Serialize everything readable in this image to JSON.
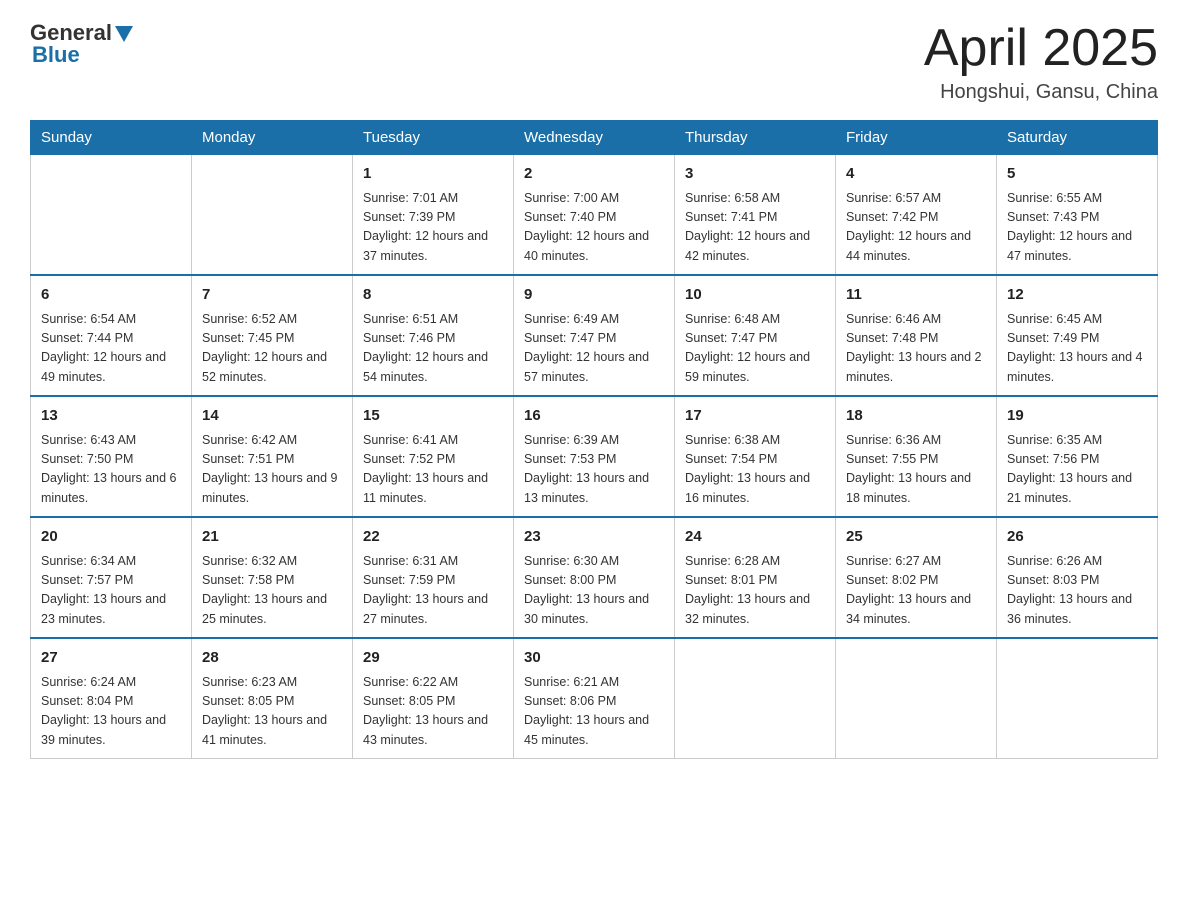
{
  "header": {
    "logo": {
      "general": "General",
      "blue": "Blue"
    },
    "title": "April 2025",
    "subtitle": "Hongshui, Gansu, China"
  },
  "days_of_week": [
    "Sunday",
    "Monday",
    "Tuesday",
    "Wednesday",
    "Thursday",
    "Friday",
    "Saturday"
  ],
  "weeks": [
    [
      {
        "day": "",
        "sunrise": "",
        "sunset": "",
        "daylight": ""
      },
      {
        "day": "",
        "sunrise": "",
        "sunset": "",
        "daylight": ""
      },
      {
        "day": "1",
        "sunrise": "Sunrise: 7:01 AM",
        "sunset": "Sunset: 7:39 PM",
        "daylight": "Daylight: 12 hours and 37 minutes."
      },
      {
        "day": "2",
        "sunrise": "Sunrise: 7:00 AM",
        "sunset": "Sunset: 7:40 PM",
        "daylight": "Daylight: 12 hours and 40 minutes."
      },
      {
        "day": "3",
        "sunrise": "Sunrise: 6:58 AM",
        "sunset": "Sunset: 7:41 PM",
        "daylight": "Daylight: 12 hours and 42 minutes."
      },
      {
        "day": "4",
        "sunrise": "Sunrise: 6:57 AM",
        "sunset": "Sunset: 7:42 PM",
        "daylight": "Daylight: 12 hours and 44 minutes."
      },
      {
        "day": "5",
        "sunrise": "Sunrise: 6:55 AM",
        "sunset": "Sunset: 7:43 PM",
        "daylight": "Daylight: 12 hours and 47 minutes."
      }
    ],
    [
      {
        "day": "6",
        "sunrise": "Sunrise: 6:54 AM",
        "sunset": "Sunset: 7:44 PM",
        "daylight": "Daylight: 12 hours and 49 minutes."
      },
      {
        "day": "7",
        "sunrise": "Sunrise: 6:52 AM",
        "sunset": "Sunset: 7:45 PM",
        "daylight": "Daylight: 12 hours and 52 minutes."
      },
      {
        "day": "8",
        "sunrise": "Sunrise: 6:51 AM",
        "sunset": "Sunset: 7:46 PM",
        "daylight": "Daylight: 12 hours and 54 minutes."
      },
      {
        "day": "9",
        "sunrise": "Sunrise: 6:49 AM",
        "sunset": "Sunset: 7:47 PM",
        "daylight": "Daylight: 12 hours and 57 minutes."
      },
      {
        "day": "10",
        "sunrise": "Sunrise: 6:48 AM",
        "sunset": "Sunset: 7:47 PM",
        "daylight": "Daylight: 12 hours and 59 minutes."
      },
      {
        "day": "11",
        "sunrise": "Sunrise: 6:46 AM",
        "sunset": "Sunset: 7:48 PM",
        "daylight": "Daylight: 13 hours and 2 minutes."
      },
      {
        "day": "12",
        "sunrise": "Sunrise: 6:45 AM",
        "sunset": "Sunset: 7:49 PM",
        "daylight": "Daylight: 13 hours and 4 minutes."
      }
    ],
    [
      {
        "day": "13",
        "sunrise": "Sunrise: 6:43 AM",
        "sunset": "Sunset: 7:50 PM",
        "daylight": "Daylight: 13 hours and 6 minutes."
      },
      {
        "day": "14",
        "sunrise": "Sunrise: 6:42 AM",
        "sunset": "Sunset: 7:51 PM",
        "daylight": "Daylight: 13 hours and 9 minutes."
      },
      {
        "day": "15",
        "sunrise": "Sunrise: 6:41 AM",
        "sunset": "Sunset: 7:52 PM",
        "daylight": "Daylight: 13 hours and 11 minutes."
      },
      {
        "day": "16",
        "sunrise": "Sunrise: 6:39 AM",
        "sunset": "Sunset: 7:53 PM",
        "daylight": "Daylight: 13 hours and 13 minutes."
      },
      {
        "day": "17",
        "sunrise": "Sunrise: 6:38 AM",
        "sunset": "Sunset: 7:54 PM",
        "daylight": "Daylight: 13 hours and 16 minutes."
      },
      {
        "day": "18",
        "sunrise": "Sunrise: 6:36 AM",
        "sunset": "Sunset: 7:55 PM",
        "daylight": "Daylight: 13 hours and 18 minutes."
      },
      {
        "day": "19",
        "sunrise": "Sunrise: 6:35 AM",
        "sunset": "Sunset: 7:56 PM",
        "daylight": "Daylight: 13 hours and 21 minutes."
      }
    ],
    [
      {
        "day": "20",
        "sunrise": "Sunrise: 6:34 AM",
        "sunset": "Sunset: 7:57 PM",
        "daylight": "Daylight: 13 hours and 23 minutes."
      },
      {
        "day": "21",
        "sunrise": "Sunrise: 6:32 AM",
        "sunset": "Sunset: 7:58 PM",
        "daylight": "Daylight: 13 hours and 25 minutes."
      },
      {
        "day": "22",
        "sunrise": "Sunrise: 6:31 AM",
        "sunset": "Sunset: 7:59 PM",
        "daylight": "Daylight: 13 hours and 27 minutes."
      },
      {
        "day": "23",
        "sunrise": "Sunrise: 6:30 AM",
        "sunset": "Sunset: 8:00 PM",
        "daylight": "Daylight: 13 hours and 30 minutes."
      },
      {
        "day": "24",
        "sunrise": "Sunrise: 6:28 AM",
        "sunset": "Sunset: 8:01 PM",
        "daylight": "Daylight: 13 hours and 32 minutes."
      },
      {
        "day": "25",
        "sunrise": "Sunrise: 6:27 AM",
        "sunset": "Sunset: 8:02 PM",
        "daylight": "Daylight: 13 hours and 34 minutes."
      },
      {
        "day": "26",
        "sunrise": "Sunrise: 6:26 AM",
        "sunset": "Sunset: 8:03 PM",
        "daylight": "Daylight: 13 hours and 36 minutes."
      }
    ],
    [
      {
        "day": "27",
        "sunrise": "Sunrise: 6:24 AM",
        "sunset": "Sunset: 8:04 PM",
        "daylight": "Daylight: 13 hours and 39 minutes."
      },
      {
        "day": "28",
        "sunrise": "Sunrise: 6:23 AM",
        "sunset": "Sunset: 8:05 PM",
        "daylight": "Daylight: 13 hours and 41 minutes."
      },
      {
        "day": "29",
        "sunrise": "Sunrise: 6:22 AM",
        "sunset": "Sunset: 8:05 PM",
        "daylight": "Daylight: 13 hours and 43 minutes."
      },
      {
        "day": "30",
        "sunrise": "Sunrise: 6:21 AM",
        "sunset": "Sunset: 8:06 PM",
        "daylight": "Daylight: 13 hours and 45 minutes."
      },
      {
        "day": "",
        "sunrise": "",
        "sunset": "",
        "daylight": ""
      },
      {
        "day": "",
        "sunrise": "",
        "sunset": "",
        "daylight": ""
      },
      {
        "day": "",
        "sunrise": "",
        "sunset": "",
        "daylight": ""
      }
    ]
  ]
}
